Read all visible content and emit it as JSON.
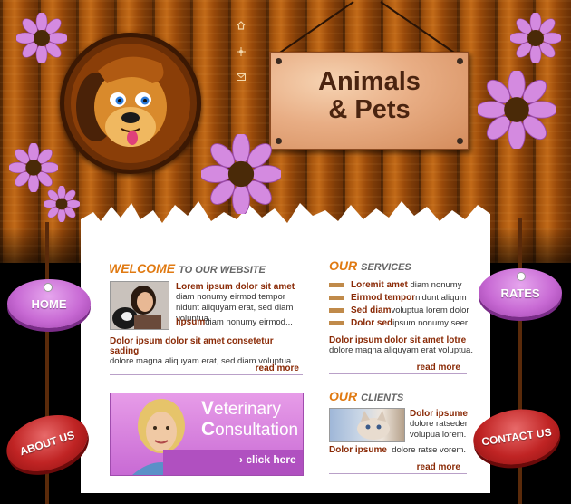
{
  "site": {
    "logo_title": [
      "Animals",
      "& Pets"
    ]
  },
  "nav": {
    "home": "HOME",
    "about": "ABOUT US",
    "rates": "RATES",
    "contact": "CONTACT US"
  },
  "top_icons": [
    "home-icon",
    "sitemap-icon",
    "mail-icon"
  ],
  "welcome": {
    "accent": "WELCOME",
    "rest": "TO OUR WEBSITE",
    "lead_title": "Lorem ipsum dolor sit amet",
    "lead_text": "diam nonumy eirmod tempor nidunt aliquyam erat, sed diam voluptua.",
    "sub_title": "Iipsum",
    "sub_text": "diam nonumy eirmod...",
    "para_title": "Dolor ipsum dolor sit amet consetetur sading",
    "para_text": "dolore magna aliquyam erat, sed diam voluptua.",
    "read_more": "read more"
  },
  "services": {
    "accent": "OUR",
    "rest": "SERVICES",
    "items": [
      {
        "bold": "Loremit amet",
        "text": "diam nonumy"
      },
      {
        "bold": "Eirmod tempor",
        "text": "nidunt aliqum"
      },
      {
        "bold": "Sed diam",
        "text": "voluptua lorem dolor"
      },
      {
        "bold": "Dolor sed",
        "text": "ipsum nonumy seer"
      }
    ],
    "para_title": "Dolor ipsum dolor sit amet lotre",
    "para_text": "dolore magna aliquyam erat voluptua.",
    "read_more": "read more"
  },
  "banner": {
    "title_cap1": "V",
    "title_rest1": "eterinary",
    "title_cap2": "C",
    "title_rest2": "onsultation",
    "button": "› click here"
  },
  "clients": {
    "accent": "OUR",
    "rest": "CLIENTS",
    "item_title": "Dolor ipsume",
    "item_text": "dolore ratseder volupua lorem.",
    "para_title": "Dolor ipsume",
    "para_text": "dolore ratse vorem.",
    "read_more": "read more"
  },
  "colors": {
    "accent_orange": "#e07a12",
    "text_dark_red": "#8a2a06",
    "purple": "#c86ad4",
    "red": "#c02424",
    "wood": "#a8560e"
  }
}
